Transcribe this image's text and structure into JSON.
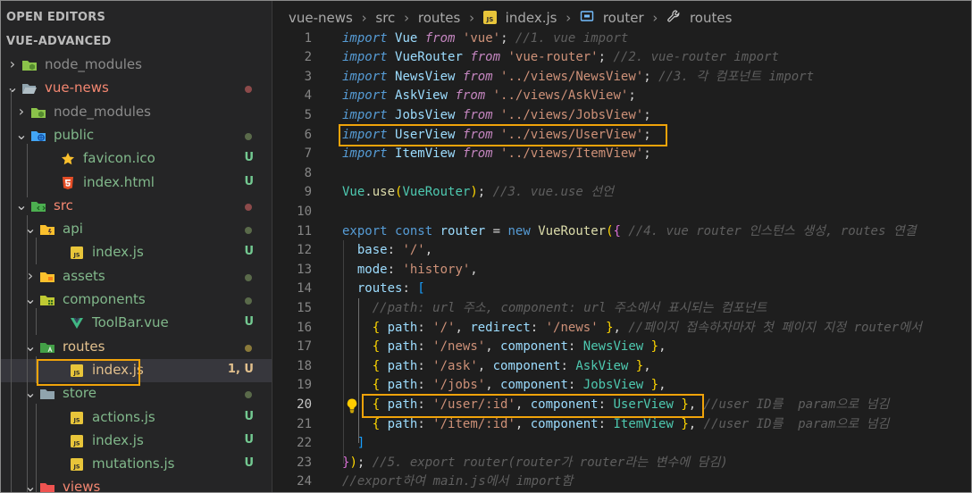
{
  "sidebar": {
    "open_editors": "OPEN EDITORS",
    "workspace": "VUE-ADVANCED",
    "tree": [
      {
        "label": "node_modules",
        "chev": "›",
        "indent": 0,
        "icon": "node-folder-icon",
        "color": "dim",
        "badge": "",
        "dot": ""
      },
      {
        "label": "vue-news",
        "chev": "⌄",
        "indent": 0,
        "icon": "folder-open-icon",
        "color": "red",
        "badge": "",
        "dot": "#8c4a4a"
      },
      {
        "label": "node_modules",
        "chev": "›",
        "indent": 1,
        "icon": "node-folder-icon",
        "color": "dim",
        "badge": "",
        "dot": ""
      },
      {
        "label": "public",
        "chev": "⌄",
        "indent": 1,
        "icon": "public-folder-icon",
        "color": "grn",
        "badge": "",
        "dot": "#5a6a4a"
      },
      {
        "label": "favicon.ico",
        "chev": "",
        "indent": 2,
        "icon": "star-icon",
        "color": "grn",
        "badge": "U",
        "dot": ""
      },
      {
        "label": "index.html",
        "chev": "",
        "indent": 2,
        "icon": "html5-icon",
        "color": "grn",
        "badge": "U",
        "dot": ""
      },
      {
        "label": "src",
        "chev": "⌄",
        "indent": 1,
        "icon": "src-folder-icon",
        "color": "red",
        "badge": "",
        "dot": "#8c4a4a"
      },
      {
        "label": "api",
        "chev": "⌄",
        "indent": 2,
        "icon": "api-folder-icon",
        "color": "grn",
        "badge": "",
        "dot": "#5a6a4a"
      },
      {
        "label": "index.js",
        "chev": "",
        "indent": 3,
        "icon": "js-file-icon",
        "color": "grn",
        "badge": "U",
        "dot": ""
      },
      {
        "label": "assets",
        "chev": "›",
        "indent": 2,
        "icon": "assets-folder-icon",
        "color": "grn",
        "badge": "",
        "dot": "#5a6a4a"
      },
      {
        "label": "components",
        "chev": "⌄",
        "indent": 2,
        "icon": "components-folder-icon",
        "color": "grn",
        "badge": "",
        "dot": "#5a6a4a"
      },
      {
        "label": "ToolBar.vue",
        "chev": "",
        "indent": 3,
        "icon": "vue-file-icon",
        "color": "grn",
        "badge": "U",
        "dot": ""
      },
      {
        "label": "routes",
        "chev": "⌄",
        "indent": 2,
        "icon": "routes-folder-icon",
        "color": "yel",
        "badge": "",
        "dot": "#8a7a3a"
      },
      {
        "label": "index.js",
        "chev": "",
        "indent": 3,
        "icon": "js-file-icon",
        "color": "yel",
        "badge": "1, U",
        "dot": "",
        "selected": true
      },
      {
        "label": "store",
        "chev": "⌄",
        "indent": 2,
        "icon": "store-folder-icon",
        "color": "grn",
        "badge": "",
        "dot": "#5a6a4a"
      },
      {
        "label": "actions.js",
        "chev": "",
        "indent": 3,
        "icon": "js-file-icon",
        "color": "grn",
        "badge": "U",
        "dot": ""
      },
      {
        "label": "index.js",
        "chev": "",
        "indent": 3,
        "icon": "js-file-icon",
        "color": "grn",
        "badge": "U",
        "dot": ""
      },
      {
        "label": "mutations.js",
        "chev": "",
        "indent": 3,
        "icon": "js-file-icon",
        "color": "grn",
        "badge": "U",
        "dot": ""
      },
      {
        "label": "views",
        "chev": "⌄",
        "indent": 2,
        "icon": "views-folder-icon",
        "color": "red",
        "badge": "",
        "dot": ""
      }
    ]
  },
  "breadcrumb": {
    "items": [
      "vue-news",
      "src",
      "routes",
      "index.js",
      "router",
      "routes"
    ]
  },
  "editor": {
    "active_line": "20",
    "lines": [
      {
        "n": "1",
        "html": "<span class='kw'>import</span> <span class='id'>Vue</span> <span class='ctrl'>from</span> <span class='str'>'vue'</span>; <span class='cmt2'>//1. vue import</span>"
      },
      {
        "n": "2",
        "html": "<span class='kw'>import</span> <span class='id'>VueRouter</span> <span class='ctrl'>from</span> <span class='str'>'vue-router'</span>; <span class='cmt2'>//2. vue-router import</span>"
      },
      {
        "n": "3",
        "html": "<span class='kw'>import</span> <span class='id'>NewsView</span> <span class='ctrl'>from</span> <span class='str'>'../views/NewsView'</span>; <span class='cmt2'>//3. 각 컴포넌트 import</span>"
      },
      {
        "n": "4",
        "html": "<span class='kw'>import</span> <span class='id'>AskView</span> <span class='ctrl'>from</span> <span class='str'>'../views/AskView'</span>;"
      },
      {
        "n": "5",
        "html": "<span class='kw'>import</span> <span class='id'>JobsView</span> <span class='ctrl'>from</span> <span class='str'>'../views/JobsView'</span>;"
      },
      {
        "n": "6",
        "html": "<span class='kw'>import</span> <span class='id'>UserView</span> <span class='ctrl'>from</span> <span class='str'>'../views/UserView'</span>;"
      },
      {
        "n": "7",
        "html": "<span class='kw'>import</span> <span class='id'>ItemView</span> <span class='ctrl'>from</span> <span class='str'>'../views/ItemView'</span>;"
      },
      {
        "n": "8",
        "html": ""
      },
      {
        "n": "9",
        "html": "<span class='cls'>Vue</span>.<span class='fn'>use</span><span class='br'>(</span><span class='cls'>VueRouter</span><span class='br'>)</span>; <span class='cmt2'>//3. vue.use 선언</span>"
      },
      {
        "n": "10",
        "html": ""
      },
      {
        "n": "11",
        "html": "<span class='kw2'>export</span> <span class='kw2'>const</span> <span class='id'>router</span> = <span class='kw2'>new</span> <span class='fn'>VueRouter</span><span class='br'>(</span><span class='br2'>{</span> <span class='cmt2'>//4. vue router 인스턴스 생성, routes 연결</span>"
      },
      {
        "n": "12",
        "html": "  <span class='id'>base</span>: <span class='str'>'/'</span>,"
      },
      {
        "n": "13",
        "html": "  <span class='id'>mode</span>: <span class='str'>'history'</span>,"
      },
      {
        "n": "14",
        "html": "  <span class='id'>routes</span>: <span class='br3'>[</span>"
      },
      {
        "n": "15",
        "html": "    <span class='cmt2'>//path: url 주소, component: url 주소에서 표시되는 컴포넌트</span>"
      },
      {
        "n": "16",
        "html": "    <span class='br'>{</span> <span class='id'>path</span>: <span class='str'>'/'</span>, <span class='id'>redirect</span>: <span class='str'>'/news'</span> <span class='br'>}</span>, <span class='cmt2'>//페이지 접속하자마자 첫 페이지 지정 router에서</span>"
      },
      {
        "n": "17",
        "html": "    <span class='br'>{</span> <span class='id'>path</span>: <span class='str'>'/news'</span>, <span class='id'>component</span>: <span class='cls'>NewsView</span> <span class='br'>}</span>,"
      },
      {
        "n": "18",
        "html": "    <span class='br'>{</span> <span class='id'>path</span>: <span class='str'>'/ask'</span>, <span class='id'>component</span>: <span class='cls'>AskView</span> <span class='br'>}</span>,"
      },
      {
        "n": "19",
        "html": "    <span class='br'>{</span> <span class='id'>path</span>: <span class='str'>'/jobs'</span>, <span class='id'>component</span>: <span class='cls'>JobsView</span> <span class='br'>}</span>,"
      },
      {
        "n": "20",
        "html": "    <span class='br'>{</span> <span class='id'>path</span>: <span class='str'>'/user/:id'</span>, <span class='id'>component</span>: <span class='cls'>UserView</span> <span class='br'>}</span>, <span class='cmt2'>//user ID를  param으로 넘김</span>"
      },
      {
        "n": "21",
        "html": "    <span class='br'>{</span> <span class='id'>path</span>: <span class='str'>'/item/:id'</span>, <span class='id'>component</span>: <span class='cls'>ItemView</span> <span class='br'>}</span>, <span class='cmt2'>//user ID를  param으로 넘김</span>"
      },
      {
        "n": "22",
        "html": "  <span class='br3'>]</span>"
      },
      {
        "n": "23",
        "html": "<span class='br2'>}</span><span class='br'>)</span>; <span class='cmt2'>//5. export router(router가 router라는 변수에 담김)</span>"
      },
      {
        "n": "24",
        "html": "<span class='cmt2'>//export하여 main.js에서 import함</span>"
      }
    ]
  },
  "colors": {
    "sidebar_bg": "#252526",
    "editor_bg": "#1e1e1e",
    "highlight": "#f0a30a",
    "selected_row": "#37373d"
  }
}
